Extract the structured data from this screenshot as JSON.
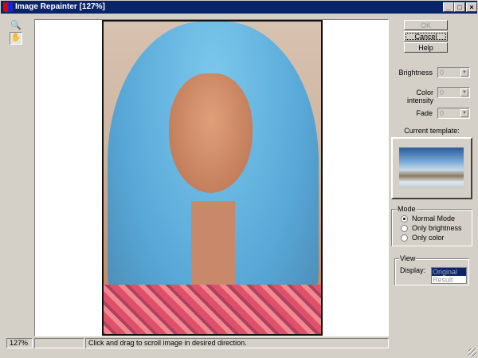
{
  "window": {
    "title": "Image Repainter [127%]",
    "minimize": "_",
    "maximize": "□",
    "close": "×"
  },
  "tools": [
    {
      "name": "zoom",
      "icon": "magnifier-icon"
    },
    {
      "name": "hand",
      "icon": "hand-icon",
      "active": true
    }
  ],
  "buttons": {
    "ok": "OK",
    "cancel": "Cancel",
    "help": "Help"
  },
  "controls": {
    "brightness_label": "Brightness",
    "brightness_value": "0",
    "color_intensity_label": "Color intensity",
    "color_intensity_value": "0",
    "fade_label": "Fade",
    "fade_value": "0"
  },
  "template": {
    "label": "Current template:"
  },
  "mode": {
    "title": "Mode",
    "options": [
      "Normal Mode",
      "Only brightness",
      "Only color"
    ],
    "selected": 0
  },
  "view": {
    "title": "View",
    "display_label": "Display:",
    "options": [
      "Original",
      "Result"
    ],
    "selected": 0
  },
  "status": {
    "zoom": "127%",
    "empty": "",
    "message": "Click and drag to scroll image in desired direction."
  }
}
